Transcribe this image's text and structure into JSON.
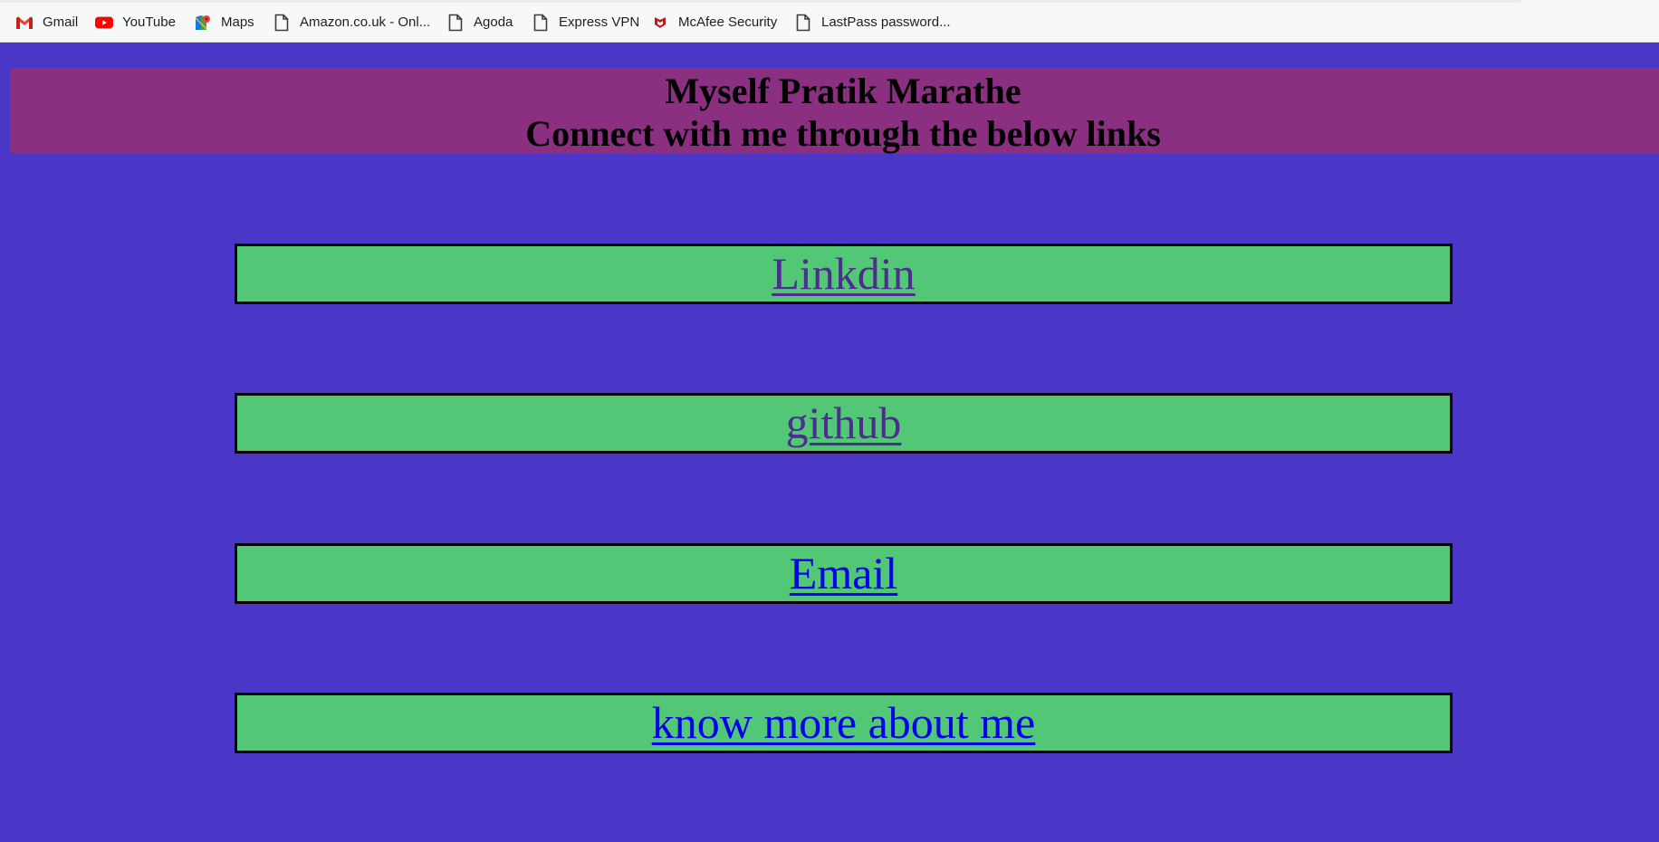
{
  "bookmarks": [
    {
      "label": "Gmail",
      "icon": "gmail-icon"
    },
    {
      "label": "YouTube",
      "icon": "youtube-icon"
    },
    {
      "label": "Maps",
      "icon": "maps-icon"
    },
    {
      "label": "Amazon.co.uk - Onl...",
      "icon": "page-icon"
    },
    {
      "label": "Agoda",
      "icon": "page-icon"
    },
    {
      "label": "Express VPN",
      "icon": "page-icon"
    },
    {
      "label": "McAfee Security",
      "icon": "mcafee-icon"
    },
    {
      "label": "LastPass password...",
      "icon": "page-icon"
    }
  ],
  "header": {
    "line1": "Myself Pratik Marathe",
    "line2": "Connect with me through the below links"
  },
  "links": [
    {
      "label": "Linkdin",
      "state": "visited"
    },
    {
      "label": "github",
      "state": "visited"
    },
    {
      "label": "Email",
      "state": "unvisited"
    },
    {
      "label": "know more about me",
      "state": "unvisited"
    }
  ],
  "colors": {
    "page_background": "#4a37c8",
    "banner_background": "#8b2f80",
    "link_box_background": "#52c776",
    "visited_link": "#4d2e8e",
    "unvisited_link": "#0000ee"
  }
}
